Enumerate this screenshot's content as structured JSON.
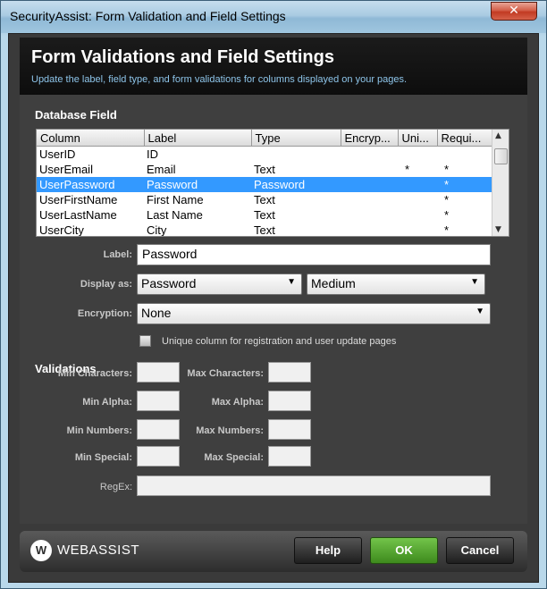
{
  "window": {
    "title": "SecurityAssist: Form Validation and Field Settings",
    "close_symbol": "✕"
  },
  "header": {
    "title": "Form Validations and Field Settings",
    "subtitle": "Update the label, field type, and form validations for columns displayed on your pages."
  },
  "database_field": {
    "section_label": "Database Field",
    "columns": [
      "Column",
      "Label",
      "Type",
      "Encryp...",
      "Uni...",
      "Requi..."
    ],
    "rows": [
      {
        "column": "UserID",
        "label": "ID",
        "type": "",
        "encryption": "",
        "unique": "",
        "required": ""
      },
      {
        "column": "UserEmail",
        "label": "Email",
        "type": "Text",
        "encryption": "",
        "unique": "*",
        "required": "*"
      },
      {
        "column": "UserPassword",
        "label": "Password",
        "type": "Password",
        "encryption": "",
        "unique": "",
        "required": "*"
      },
      {
        "column": "UserFirstName",
        "label": "First Name",
        "type": "Text",
        "encryption": "",
        "unique": "",
        "required": "*"
      },
      {
        "column": "UserLastName",
        "label": "Last Name",
        "type": "Text",
        "encryption": "",
        "unique": "",
        "required": "*"
      },
      {
        "column": "UserCity",
        "label": "City",
        "type": "Text",
        "encryption": "",
        "unique": "",
        "required": "*"
      }
    ],
    "selected_row": 2
  },
  "settings": {
    "label_caption": "Label:",
    "label_value": "Password",
    "display_as_caption": "Display as:",
    "display_as_value": "Password",
    "display_size_value": "Medium",
    "encryption_caption": "Encryption:",
    "encryption_value": "None",
    "unique_checkbox_label": "Unique column for registration and user update pages",
    "unique_checked": false
  },
  "validations": {
    "section_label": "Validations",
    "min_characters": "Min Characters:",
    "max_characters": "Max Characters:",
    "min_alpha": "Min Alpha:",
    "max_alpha": "Max Alpha:",
    "min_numbers": "Min Numbers:",
    "max_numbers": "Max Numbers:",
    "min_special": "Min Special:",
    "max_special": "Max Special:",
    "regex": "RegEx:"
  },
  "footer": {
    "logo_text": "WEBASSIST",
    "logo_mark": "W",
    "help_label": "Help",
    "ok_label": "OK",
    "cancel_label": "Cancel"
  }
}
